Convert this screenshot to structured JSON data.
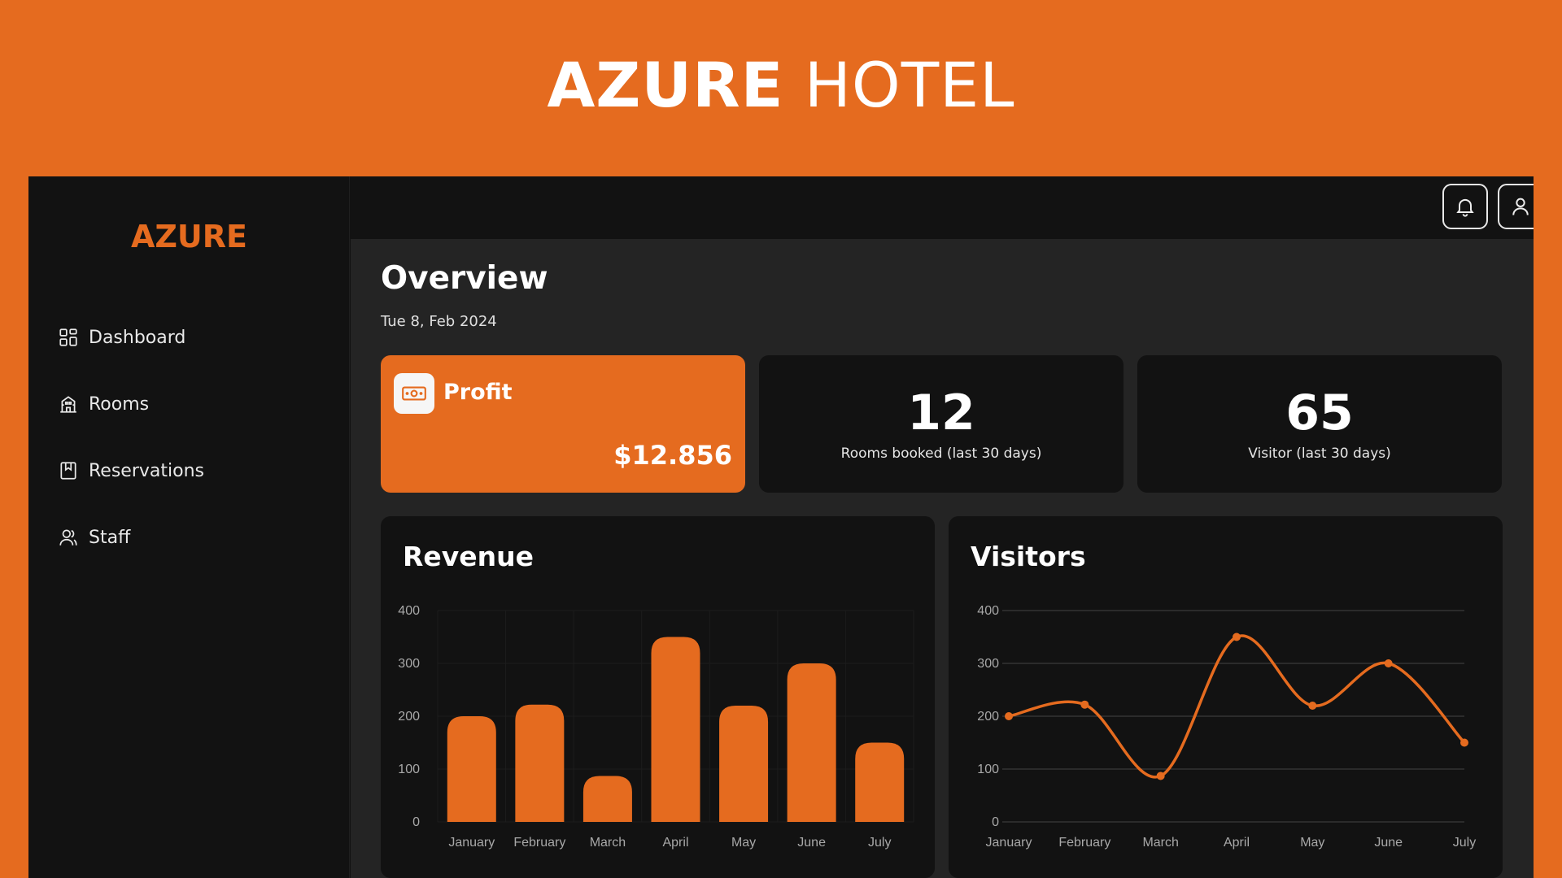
{
  "banner": {
    "title_strong": "AZURE",
    "title_light": "HOTEL"
  },
  "sidebar": {
    "brand": "AZURE",
    "items": [
      {
        "label": "Dashboard",
        "icon": "dashboard-icon"
      },
      {
        "label": "Rooms",
        "icon": "building-icon"
      },
      {
        "label": "Reservations",
        "icon": "bookmark-icon"
      },
      {
        "label": "Staff",
        "icon": "users-icon"
      }
    ]
  },
  "topbar": {
    "icons": [
      "bell-icon",
      "user-icon"
    ]
  },
  "main": {
    "title": "Overview",
    "date": "Tue 8, Feb 2024",
    "cards": {
      "profit": {
        "label": "Profit",
        "value": "$12.856",
        "icon": "money-icon"
      },
      "rooms": {
        "value": "12",
        "label": "Rooms booked (last 30 days)"
      },
      "visitors": {
        "value": "65",
        "label": "Visitor (last 30 days)"
      }
    },
    "panels": {
      "revenue_title": "Revenue",
      "visitors_title": "Visitors"
    }
  },
  "colors": {
    "accent": "#E56B1F",
    "background": "#121212",
    "panel": "#242424"
  },
  "chart_data": [
    {
      "type": "bar",
      "title": "Revenue",
      "categories": [
        "January",
        "February",
        "March",
        "April",
        "May",
        "June",
        "July"
      ],
      "values": [
        200,
        222,
        87,
        350,
        220,
        300,
        150
      ],
      "ylim": [
        0,
        400
      ],
      "yticks": [
        0,
        100,
        200,
        300,
        400
      ],
      "grid": true
    },
    {
      "type": "line",
      "title": "Visitors",
      "categories": [
        "January",
        "February",
        "March",
        "April",
        "May",
        "June",
        "July"
      ],
      "values": [
        200,
        222,
        87,
        350,
        220,
        300,
        150
      ],
      "ylim": [
        0,
        400
      ],
      "yticks": [
        0,
        100,
        200,
        300,
        400
      ],
      "grid": true,
      "smooth": true
    }
  ]
}
